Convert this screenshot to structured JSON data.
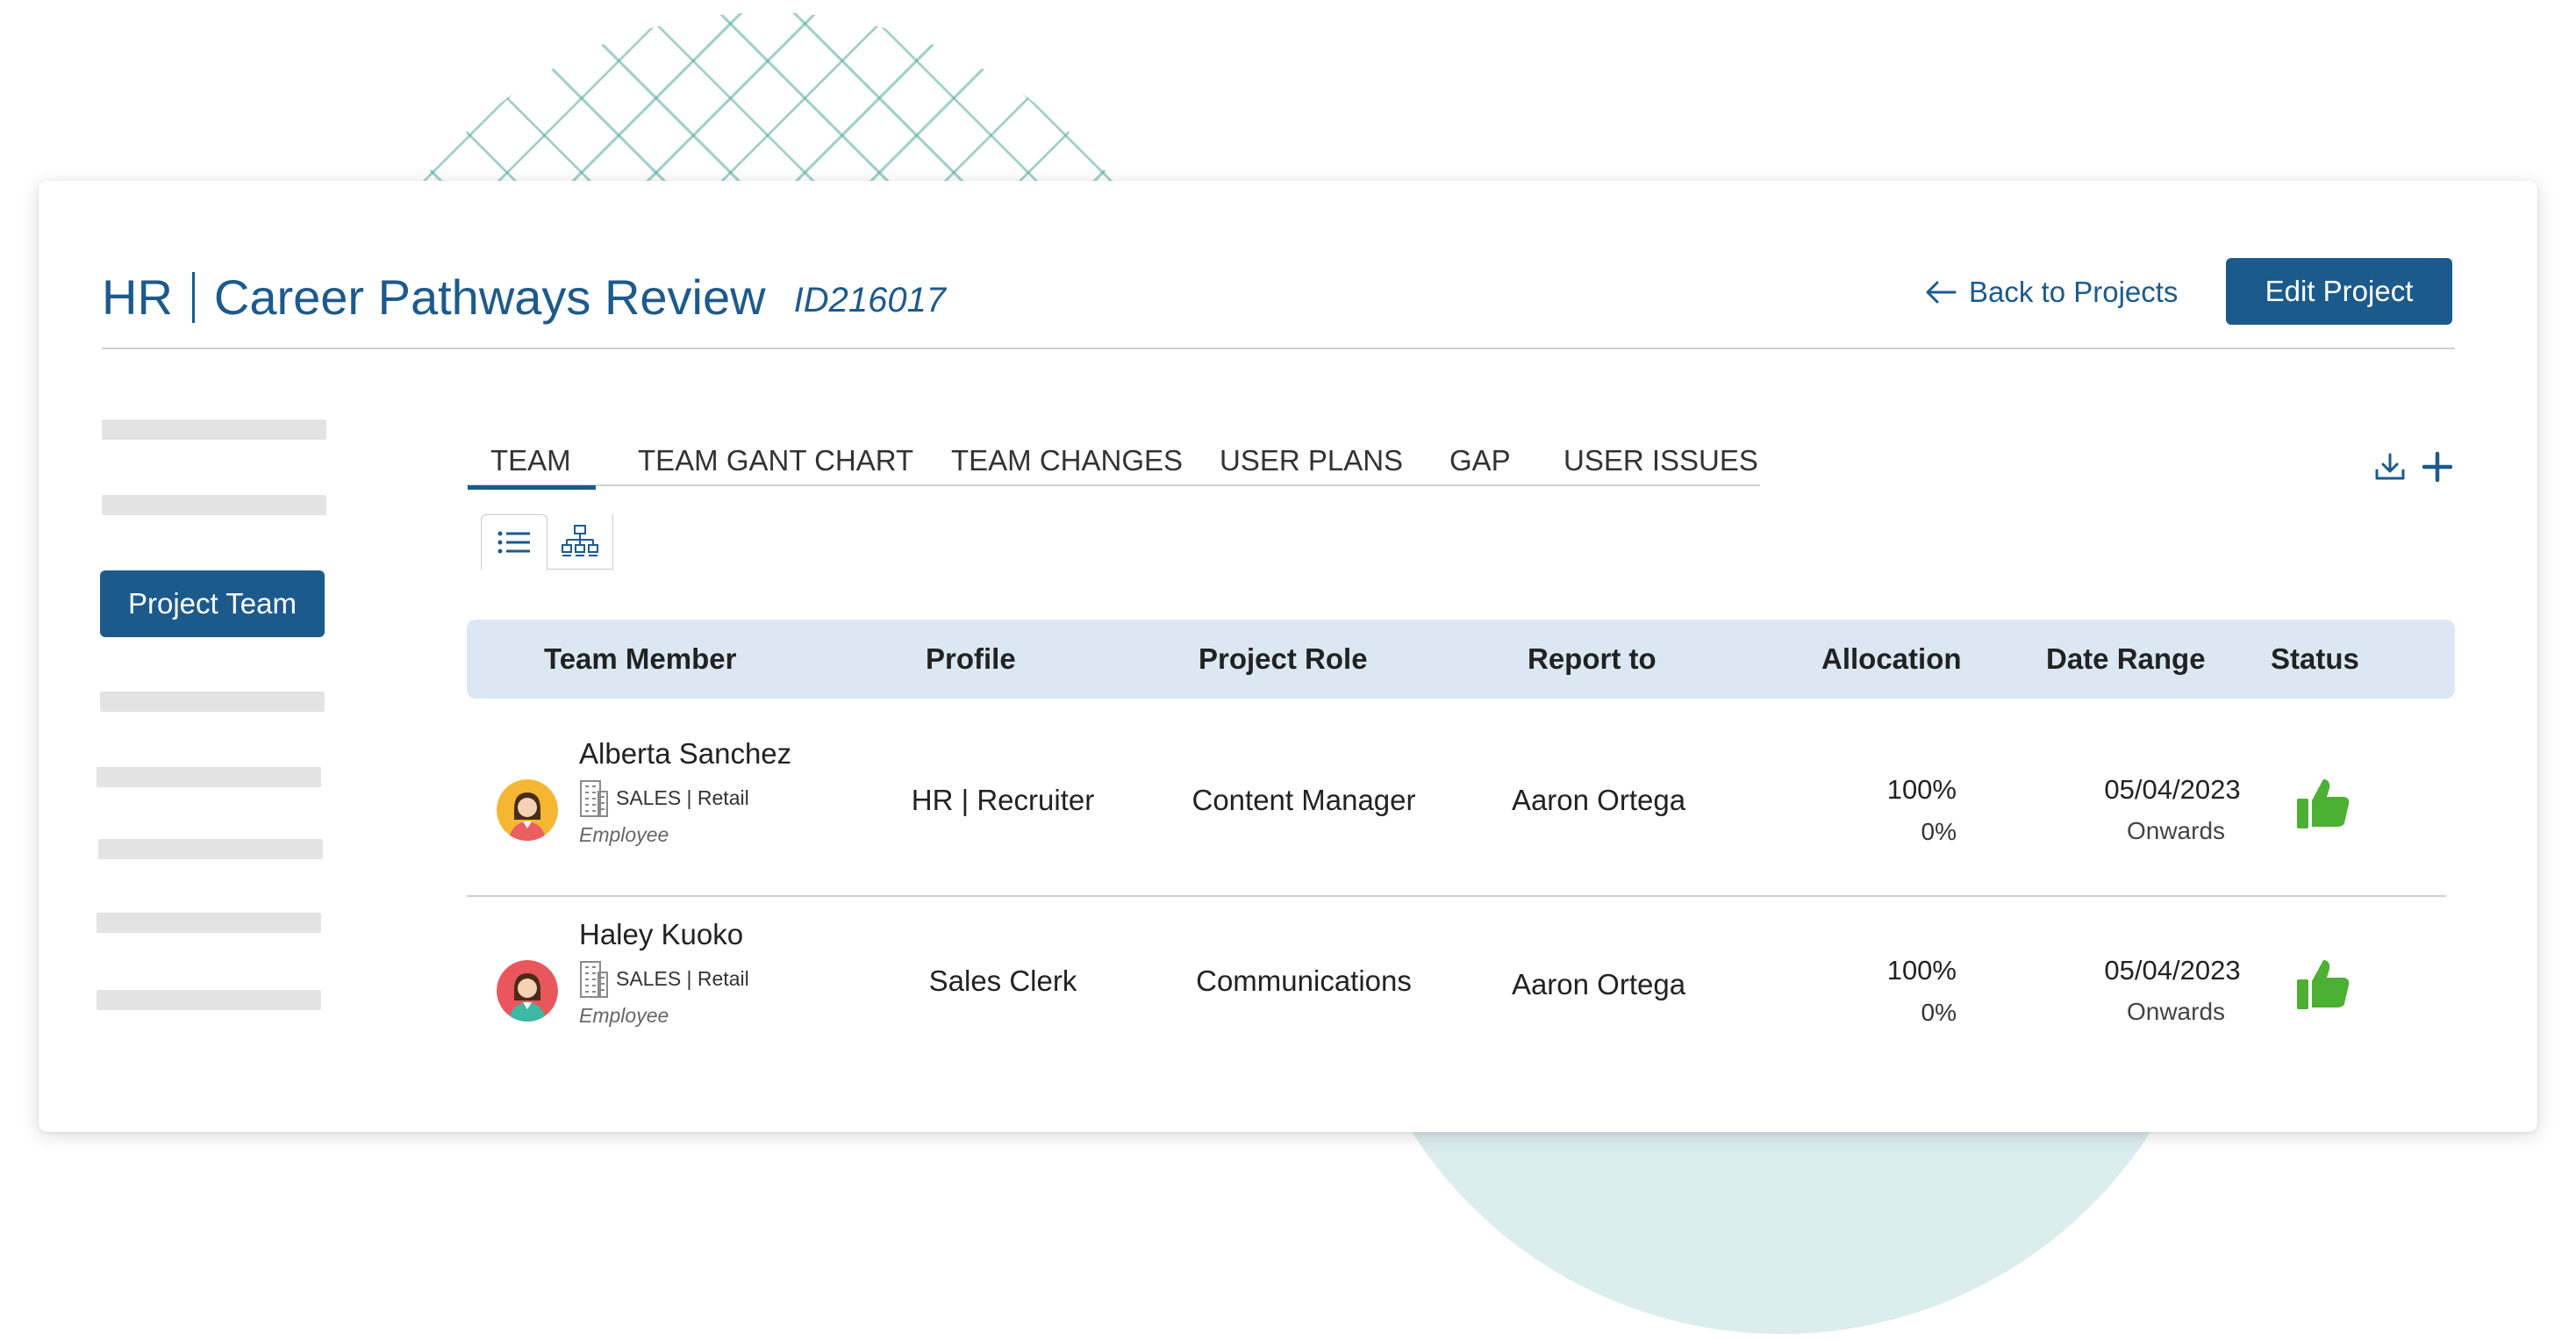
{
  "header": {
    "department": "HR",
    "project_name": "Career Pathways Review",
    "project_id": "ID216017",
    "back_label": "Back to Projects",
    "edit_label": "Edit Project"
  },
  "sidebar": {
    "active_label": "Project Team"
  },
  "tabs": [
    {
      "label": "TEAM",
      "active": true
    },
    {
      "label": "TEAM GANT CHART",
      "active": false
    },
    {
      "label": "TEAM CHANGES",
      "active": false
    },
    {
      "label": "USER PLANS",
      "active": false
    },
    {
      "label": "GAP",
      "active": false
    },
    {
      "label": "USER ISSUES",
      "active": false
    }
  ],
  "toolbar": {
    "icons": [
      "download-icon",
      "add-icon"
    ],
    "view_modes": [
      "list-view-icon",
      "org-chart-icon"
    ]
  },
  "table": {
    "columns": [
      "Team Member",
      "Profile",
      "Project Role",
      "Report to",
      "Allocation",
      "Date Range",
      "Status"
    ],
    "rows": [
      {
        "name": "Alberta Sanchez",
        "dept": "SALES | Retail",
        "type": "Employee",
        "profile": "HR | Recruiter",
        "role": "Content Manager",
        "report_to": "Aaron Ortega",
        "allocation_primary": "100%",
        "allocation_secondary": "0%",
        "date_start": "05/04/2023",
        "date_suffix": "Onwards",
        "status": "thumbs-up-icon",
        "avatar_bg": "#f5b731"
      },
      {
        "name": "Haley Kuoko",
        "dept": "SALES | Retail",
        "type": "Employee",
        "profile": "Sales Clerk",
        "role": "Communications",
        "report_to": "Aaron Ortega",
        "allocation_primary": "100%",
        "allocation_secondary": "0%",
        "date_start": "05/04/2023",
        "date_suffix": "Onwards",
        "status": "thumbs-up-icon",
        "avatar_bg": "#e9575c"
      }
    ]
  },
  "colors": {
    "primary": "#1d5a8c",
    "header_bg": "#dbe8f3",
    "status_green": "#4cb033"
  }
}
